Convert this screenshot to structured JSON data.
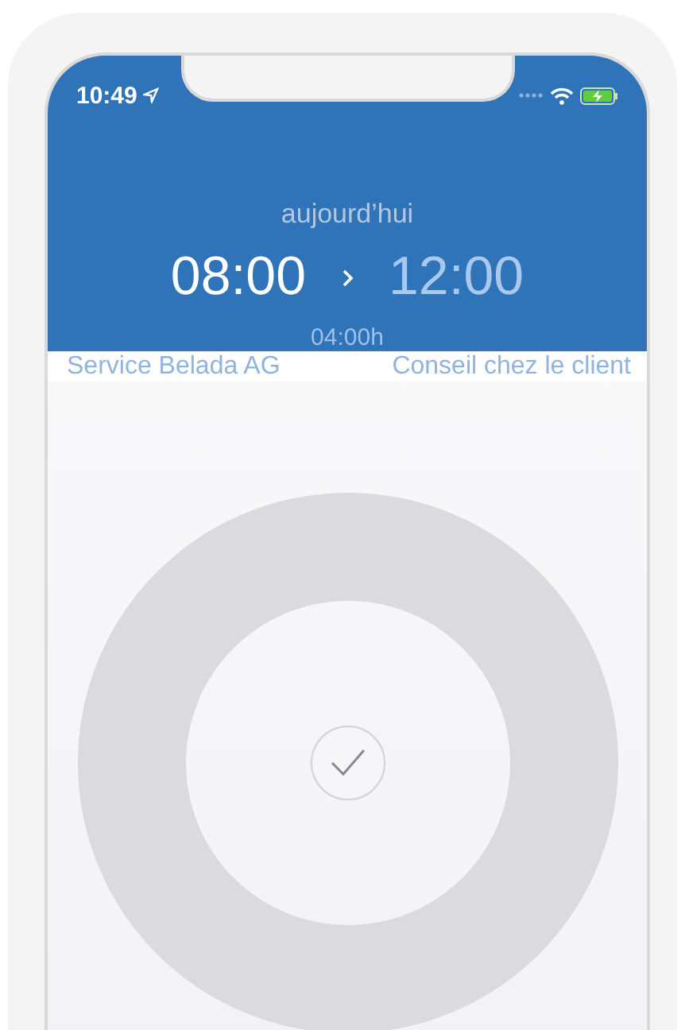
{
  "status_bar": {
    "time": "10:49"
  },
  "header": {
    "date_label": "aujourd’hui",
    "start_time": "08:00",
    "end_time": "12:00",
    "duration": "04:00h"
  },
  "details": {
    "client": "Service Belada AG",
    "activity": "Conseil chez le client"
  }
}
